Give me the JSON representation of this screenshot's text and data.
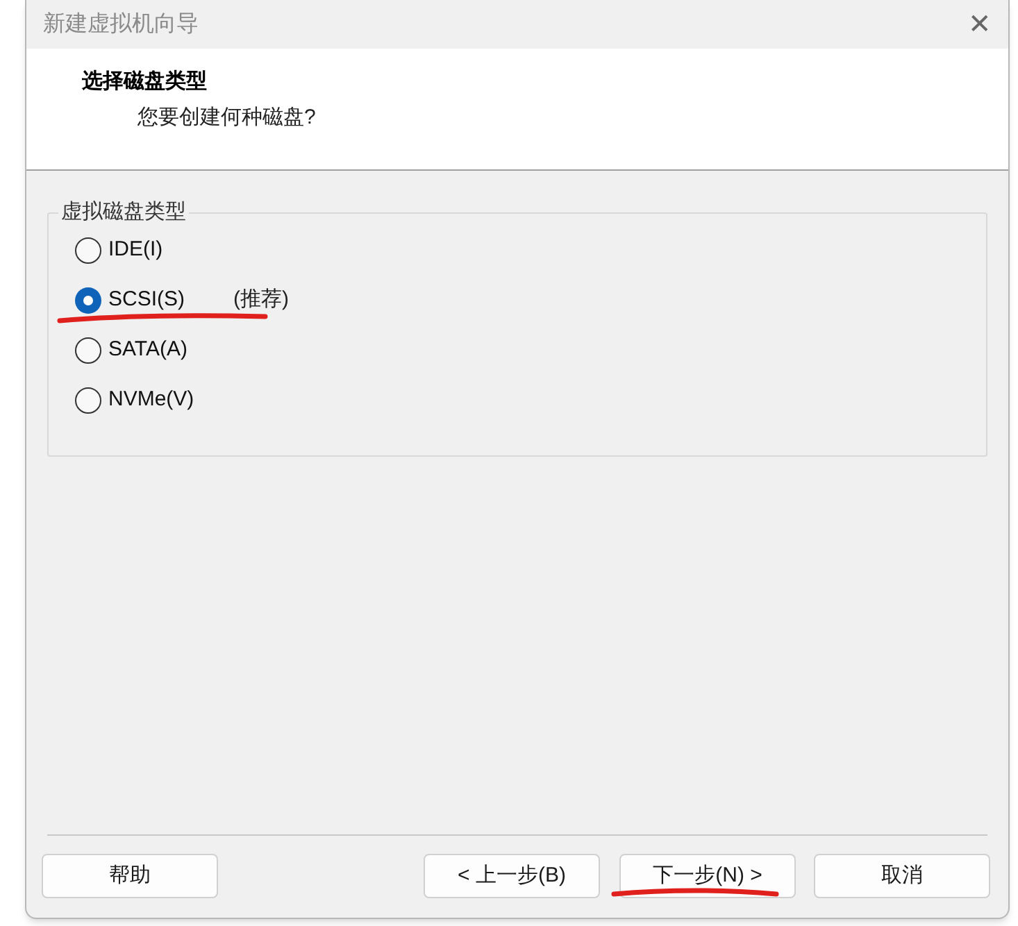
{
  "window": {
    "title": "新建虚拟机向导",
    "close": "✕"
  },
  "header": {
    "title": "选择磁盘类型",
    "subtitle": "您要创建何种磁盘?"
  },
  "group": {
    "label": "虚拟磁盘类型",
    "options": [
      {
        "label": "IDE(I)",
        "selected": false
      },
      {
        "label": "SCSI(S)",
        "selected": true,
        "note": "(推荐)"
      },
      {
        "label": "SATA(A)",
        "selected": false
      },
      {
        "label": "NVMe(V)",
        "selected": false
      }
    ]
  },
  "buttons": {
    "help": "帮助",
    "back": "< 上一步(B)",
    "next": "下一步(N) >",
    "cancel": "取消"
  }
}
